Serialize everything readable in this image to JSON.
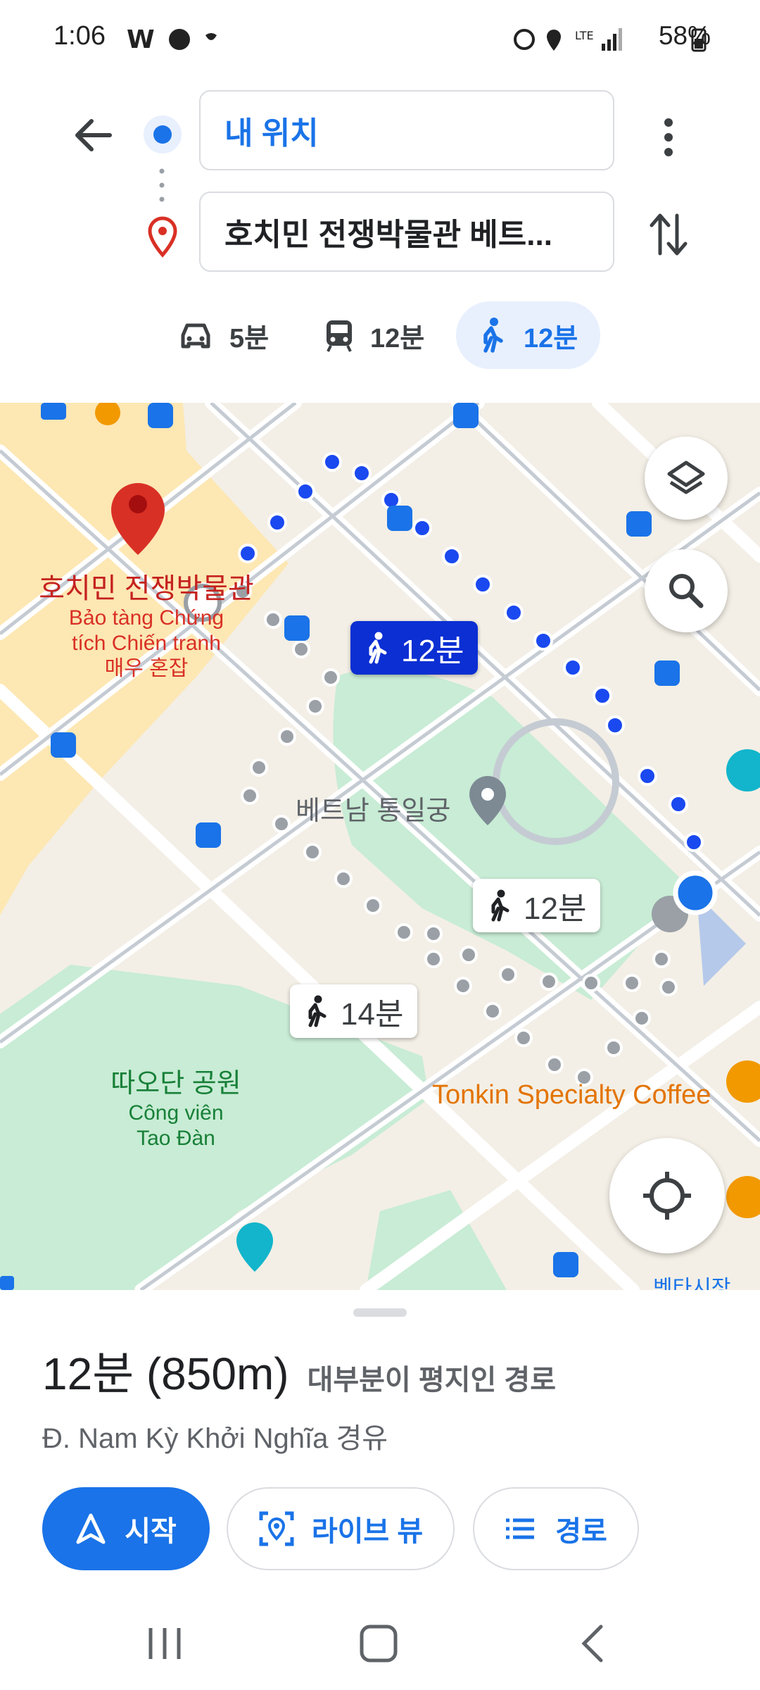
{
  "status_bar": {
    "time": "1:06",
    "battery": "58%"
  },
  "directions": {
    "origin": "내 위치",
    "destination": "호치민 전쟁박물관 베트...",
    "modes": [
      {
        "icon": "car-icon",
        "label": "5분"
      },
      {
        "icon": "transit-icon",
        "label": "12분"
      },
      {
        "icon": "walk-icon",
        "label": "12분",
        "selected": true
      }
    ]
  },
  "map": {
    "labels": {
      "museum_ko": "호치민 전쟁박물관",
      "museum_vi1": "Bảo tàng Chứng",
      "museum_vi2": "tích Chiến tranh",
      "museum_ko2": "매우 혼잡",
      "palace": "베트남 통일궁",
      "park_ko": "따오단 공원",
      "park_vi1": "Công viên",
      "park_vi2": "Tao Đàn",
      "coffee": "Tonkin Specialty Coffee",
      "market": "벤타시장"
    },
    "route_tags": {
      "selected": "12분",
      "alt1": "12분",
      "alt2": "14분"
    }
  },
  "summary": {
    "duration": "12분 (850m)",
    "note": "대부분이 평지인 경로",
    "via": "Đ. Nam Kỳ Khởi Nghĩa 경유"
  },
  "actions": {
    "start": "시작",
    "live_view": "라이브 뷰",
    "steps": "경로"
  },
  "colors": {
    "accent": "#1a73e8",
    "route": "#1a49f0",
    "park": "#c8ecd5",
    "pin": "#d93025"
  }
}
